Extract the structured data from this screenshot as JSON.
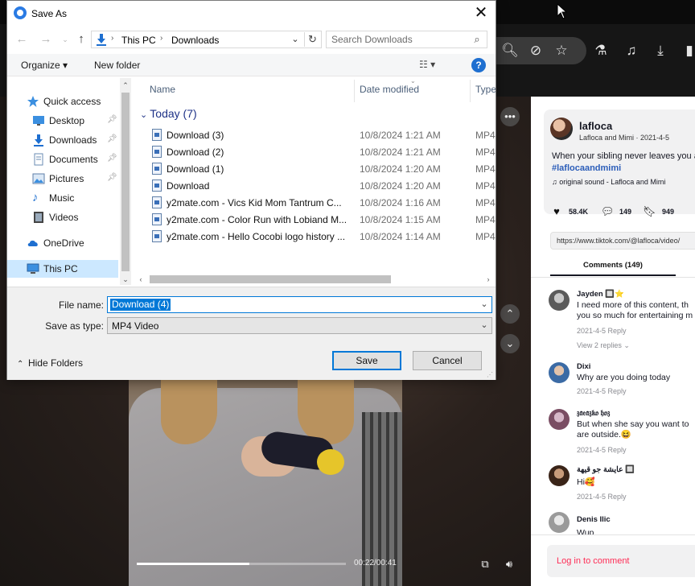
{
  "dialog": {
    "title": "Save As",
    "close_glyph": "✕",
    "address": {
      "crumbs": [
        "This PC",
        "Downloads"
      ]
    },
    "search": {
      "placeholder": "Search Downloads"
    },
    "commands": {
      "organize": "Organize ▾",
      "new_folder": "New folder",
      "view": "☷ ▾",
      "help": "?"
    },
    "nav_pane": {
      "items": [
        {
          "label": "Quick access",
          "icon": "star-icon",
          "pinned": false
        },
        {
          "label": "Desktop",
          "icon": "desktop-icon",
          "pinned": true
        },
        {
          "label": "Downloads",
          "icon": "download-arrow-icon",
          "pinned": true
        },
        {
          "label": "Documents",
          "icon": "document-icon",
          "pinned": true
        },
        {
          "label": "Pictures",
          "icon": "picture-icon",
          "pinned": true
        },
        {
          "label": "Music",
          "icon": "music-icon",
          "pinned": false
        },
        {
          "label": "Videos",
          "icon": "video-icon",
          "pinned": false
        },
        {
          "label": "OneDrive",
          "icon": "cloud-icon",
          "pinned": false
        },
        {
          "label": "This PC",
          "icon": "computer-icon",
          "pinned": false,
          "selected": true
        }
      ]
    },
    "columns": {
      "name": "Name",
      "date": "Date modified",
      "type": "Type"
    },
    "group": "Today (7)",
    "files": [
      {
        "name": "Download (3)",
        "date": "10/8/2024 1:21 AM",
        "type": "MP4"
      },
      {
        "name": "Download (2)",
        "date": "10/8/2024 1:21 AM",
        "type": "MP4"
      },
      {
        "name": "Download (1)",
        "date": "10/8/2024 1:20 AM",
        "type": "MP4"
      },
      {
        "name": "Download",
        "date": "10/8/2024 1:20 AM",
        "type": "MP4"
      },
      {
        "name": "y2mate.com - Vics Kid  Mom Tantrum C...",
        "date": "10/8/2024 1:16 AM",
        "type": "MP4"
      },
      {
        "name": "y2mate.com - Color Run with Lobiand M...",
        "date": "10/8/2024 1:15 AM",
        "type": "MP4"
      },
      {
        "name": "y2mate.com - Hello Cocobi logo history ...",
        "date": "10/8/2024 1:14 AM",
        "type": "MP4"
      }
    ],
    "form": {
      "file_name_label": "File name:",
      "file_name_value": "Download (4)",
      "save_type_label": "Save as type:",
      "save_type_value": "MP4 Video",
      "hide_folders": "Hide Folders",
      "save": "Save",
      "cancel": "Cancel"
    }
  },
  "video": {
    "time": "00:22/00:41",
    "progress": 0.54
  },
  "tiktok": {
    "author": "lafloca",
    "author_sub": "Lafloca and Mimi · 2021-4-5",
    "caption": "When your sibling never leaves you a",
    "hashtag": "#laflocaandmimi",
    "sound": "♫  original sound - Lafloca and Mimi",
    "likes": "58.4K",
    "comments_count": "149",
    "saves": "949",
    "link": "https://www.tiktok.com/@lafloca/video/",
    "comments_tab": "Comments (149)",
    "comments": [
      {
        "user": "Jayden 🔲⭐",
        "text": [
          "I need more of this content, th",
          "you so much for entertaining m"
        ],
        "meta": "2021-4-5  Reply",
        "replies": "View 2 replies ⌄"
      },
      {
        "user": "Dixi",
        "text": [
          "Why are you doing today"
        ],
        "meta": "2021-4-5  Reply"
      },
      {
        "user": "𝔷𝔞𝔢𝔞𝔷𝔨𝔬 𝔥𝔬𝔷",
        "text": [
          "But when she say you want to",
          "are outside.😆"
        ],
        "meta": "2021-4-5  Reply"
      },
      {
        "user": "عايشة جو قيهة 🔲",
        "text": [
          "Hi🥰"
        ],
        "meta": "2021-4-5  Reply"
      },
      {
        "user": "Denis Ilic",
        "text": [
          "Wup"
        ],
        "meta": ""
      }
    ],
    "login": "Log in to comment"
  }
}
